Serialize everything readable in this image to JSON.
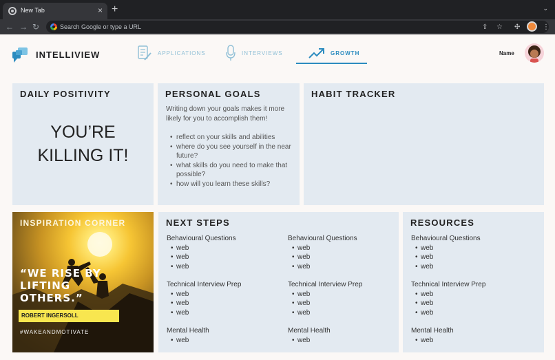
{
  "browser": {
    "tab_title": "New Tab",
    "tab_close": "×",
    "new_tab": "+",
    "tab_menu": "⌄",
    "address_placeholder": "Search Google or type a URL"
  },
  "app": {
    "brand": "INTELLIVIEW",
    "nav": [
      {
        "label": "APPLICATIONS",
        "active": false
      },
      {
        "label": "INTERVIEWS",
        "active": false
      },
      {
        "label": "GROWTH",
        "active": true
      }
    ],
    "user_name": "Name",
    "accent_color": "#2b8bbf"
  },
  "daily": {
    "title": "DAILY POSITIVITY",
    "message_line1": "YOU’RE",
    "message_line2": "KILLING IT!"
  },
  "goals": {
    "title": "PERSONAL GOALS",
    "intro": "Writing down your goals makes it more likely for you to accomplish them!",
    "items": [
      "reflect on your skills and abilities",
      "where do you see yourself in the near future?",
      "what skills do you need to make that possible?",
      "how will you learn these skills?"
    ]
  },
  "habit": {
    "title": "HABIT TRACKER"
  },
  "inspiration": {
    "title": "INSPIRATION CORNER",
    "quote": "“WE RISE BY LIFTING OTHERS.”",
    "author": "ROBERT INGERSOLL",
    "tag": "#WAKEANDMOTIVATE"
  },
  "next_steps": {
    "title": "NEXT STEPS",
    "columns": [
      {
        "groups": [
          {
            "heading": "Behavioural Questions",
            "links": [
              "web",
              "web",
              "web"
            ]
          },
          {
            "heading": "Technical Interview Prep",
            "links": [
              "web",
              "web",
              "web"
            ]
          },
          {
            "heading": "Mental Health",
            "links": [
              "web"
            ]
          }
        ]
      },
      {
        "groups": [
          {
            "heading": "Behavioural Questions",
            "links": [
              "web",
              "web",
              "web"
            ]
          },
          {
            "heading": "Technical Interview Prep",
            "links": [
              "web",
              "web",
              "web"
            ]
          },
          {
            "heading": "Mental Health",
            "links": [
              "web"
            ]
          }
        ]
      }
    ]
  },
  "resources": {
    "title": "RESOURCES",
    "groups": [
      {
        "heading": "Behavioural Questions",
        "links": [
          "web",
          "web",
          "web"
        ]
      },
      {
        "heading": "Technical Interview Prep",
        "links": [
          "web",
          "web",
          "web"
        ]
      },
      {
        "heading": "Mental Health",
        "links": [
          "web"
        ]
      }
    ]
  }
}
